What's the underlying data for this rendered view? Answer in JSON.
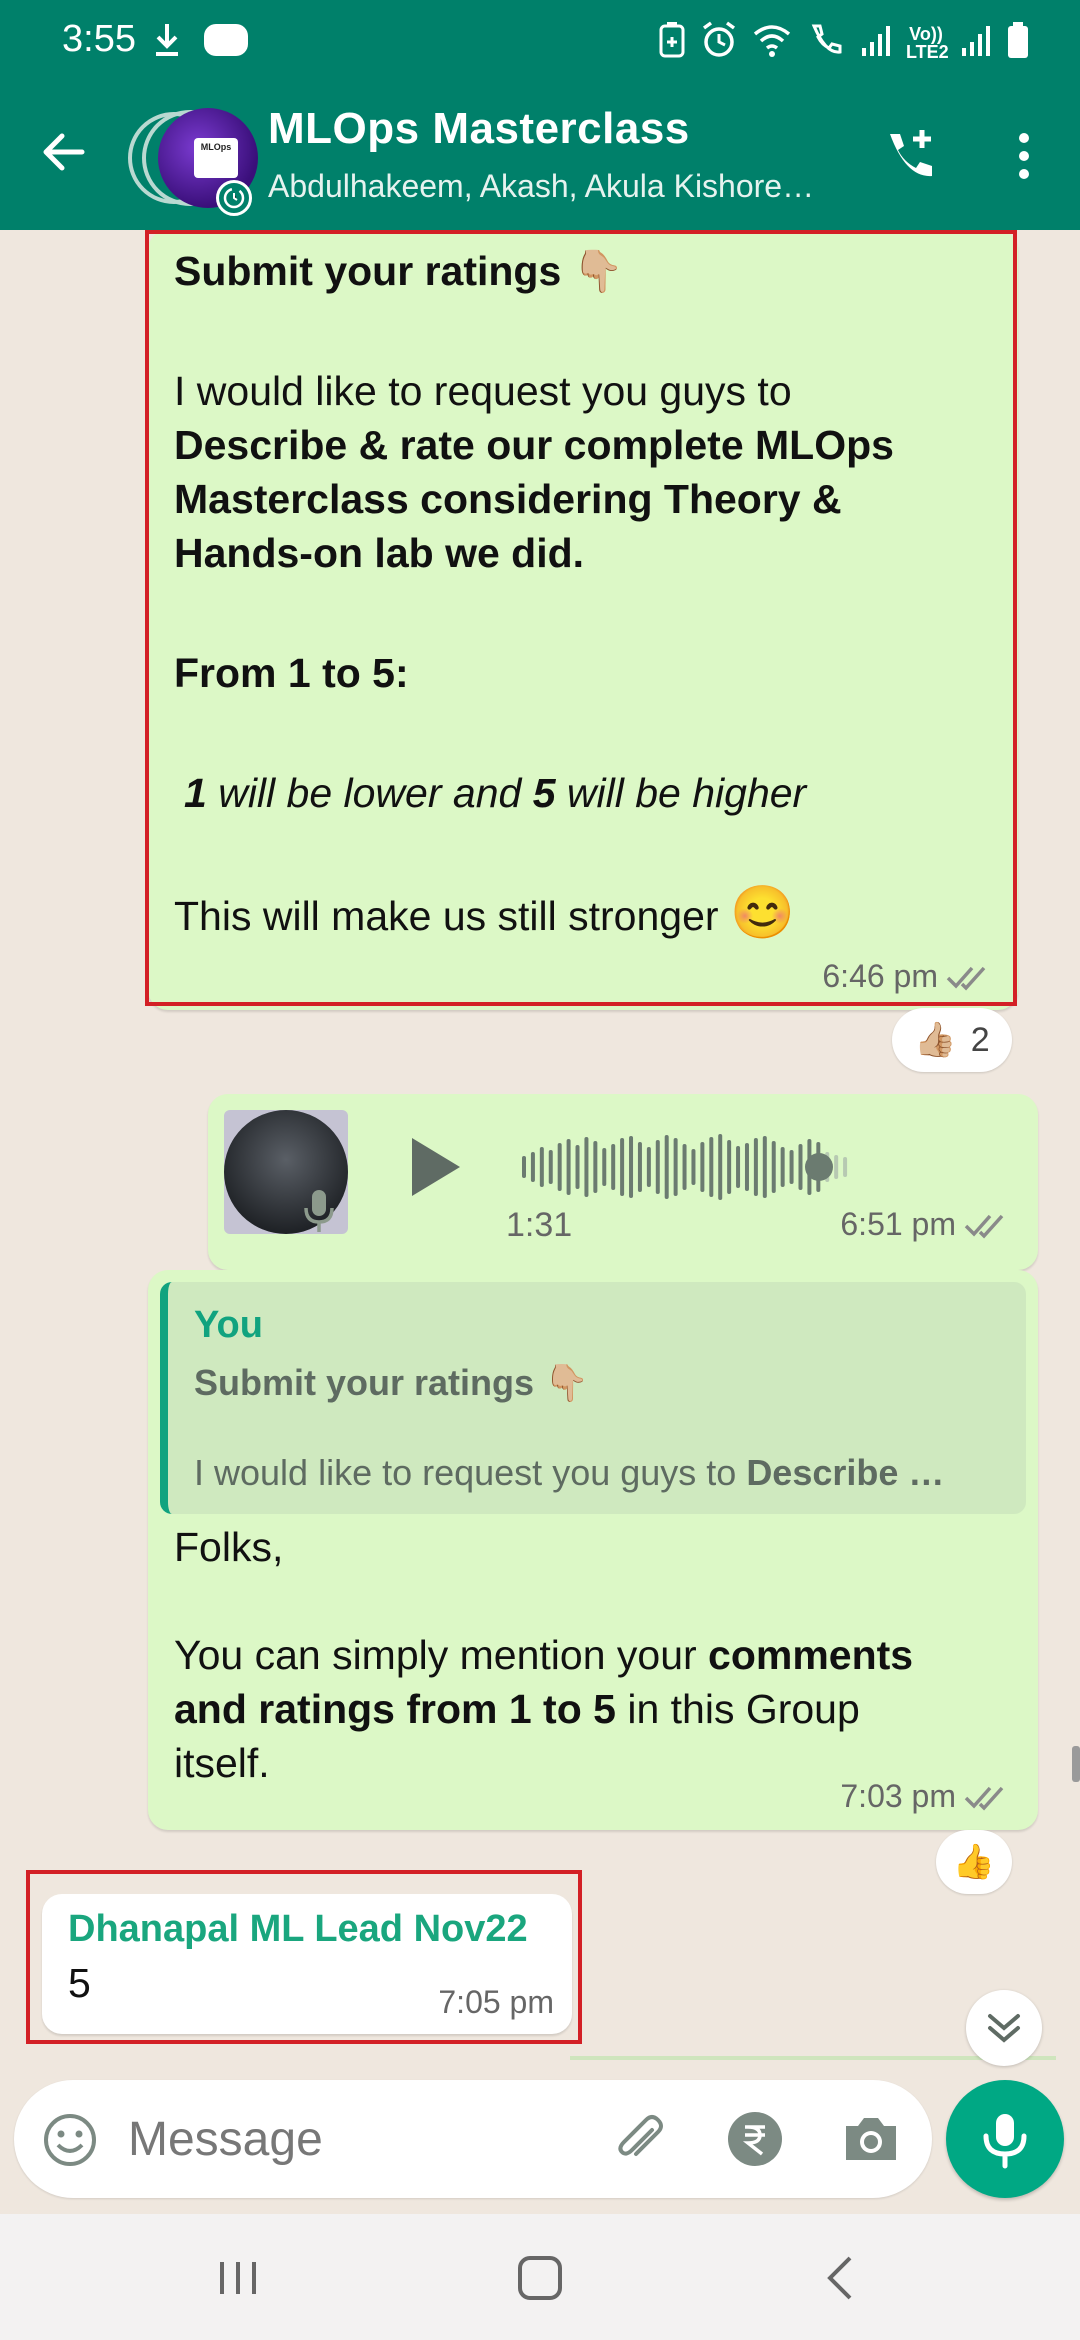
{
  "status_bar": {
    "time": "3:55",
    "network_label_top": "Vo))",
    "network_label_bottom": "LTE2",
    "icons": [
      "download-icon",
      "notification-blob-icon",
      "battery-saver-icon",
      "alarm-icon",
      "wifi-icon",
      "wifi-call-icon",
      "signal-icon",
      "signal-2-icon",
      "battery-icon"
    ]
  },
  "header": {
    "title": "MLOps Masterclass",
    "subtitle": "Abdulhakeem, Akash, Akula Kishore…",
    "avatar_card_text": "MLOps",
    "colors": {
      "bar": "#00806a"
    }
  },
  "messages": {
    "first": {
      "heading": "Submit your ratings",
      "heading_emoji": "👇🏼",
      "line1": "I would like to request you guys to",
      "bold_lines": [
        "Describe & rate our complete MLOps",
        "Masterclass considering Theory &",
        "Hands-on lab we did."
      ],
      "range_heading": "From 1 to 5:",
      "scale_num_low": "1",
      "scale_text_mid": " will be lower and ",
      "scale_num_high": "5",
      "scale_text_end": " will be higher",
      "closing": "This will make us still stronger",
      "closing_emoji": "😊",
      "time": "6:46 pm",
      "reaction_emoji": "👍🏼",
      "reaction_count": "2"
    },
    "voice": {
      "duration": "1:31",
      "time": "6:51 pm",
      "progress": 0.9
    },
    "reply": {
      "quote_author": "You",
      "quote_title": "Submit your ratings",
      "quote_title_emoji": "👇🏼",
      "quote_body_plain": "I would like to request you guys to ",
      "quote_body_bold": "Describe …",
      "line1": "Folks,",
      "line2_plain": " You can simply mention your ",
      "line2_bold": "comments",
      "line3_bold": "and ratings from 1 to 5",
      "line3_plain": " in this Group",
      "line4": "itself.",
      "time": "7:03 pm",
      "reaction_emoji": "👍"
    },
    "incoming": {
      "sender": "Dhanapal ML Lead Nov22",
      "text": "5",
      "time": "7:05 pm"
    }
  },
  "composer": {
    "placeholder": "Message"
  },
  "colors": {
    "outgoing_bubble": "#dcf8c6",
    "incoming_bubble": "#ffffff",
    "chat_background": "#efe7de",
    "accent_green": "#00a884",
    "highlight_box": "#d32026"
  }
}
